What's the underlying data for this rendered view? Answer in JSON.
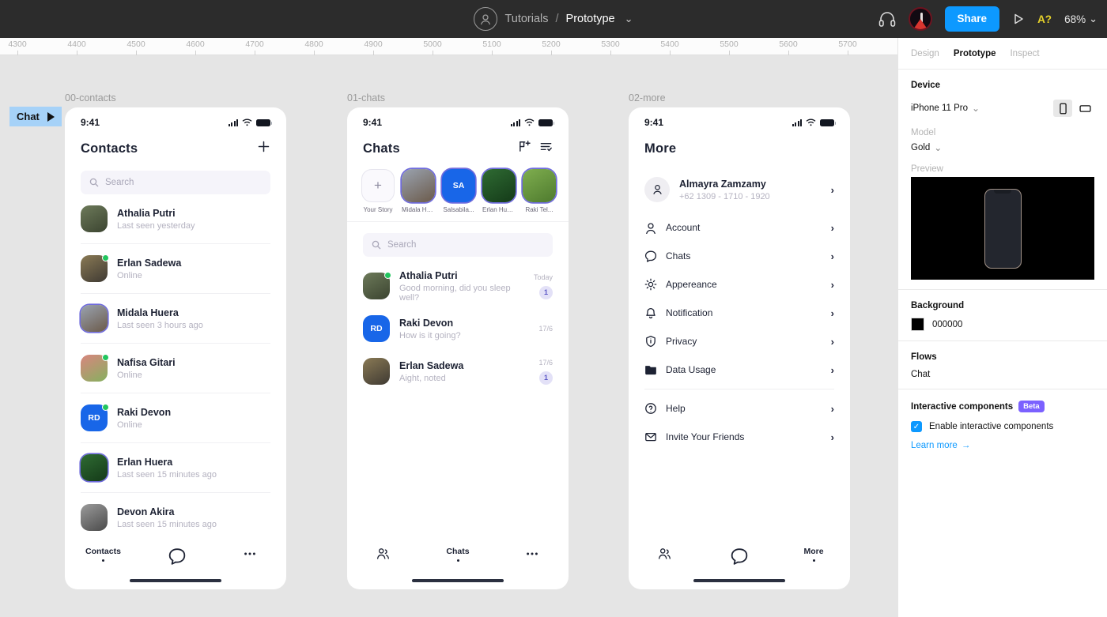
{
  "toolbar": {
    "avatar_icon": "user-circle-icon",
    "breadcrumb_project": "Tutorials",
    "breadcrumb_separator": "/",
    "breadcrumb_file": "Prototype",
    "file_chevron": "⌄",
    "headphones_icon": "headphones-icon",
    "user_avatar": "user-avatar",
    "share_label": "Share",
    "present_icon": "play-icon",
    "a11y_label": "A?",
    "zoom_label": "68%",
    "zoom_chevron": "⌄",
    "accent_color": "#0d99ff",
    "bg_color": "#2c2c2c"
  },
  "ruler": {
    "ticks": [
      "4300",
      "4400",
      "4500",
      "4600",
      "4700",
      "4800",
      "4900",
      "5000",
      "5100",
      "5200",
      "5300",
      "5400",
      "5500",
      "5600",
      "5700"
    ]
  },
  "canvas": {
    "flow_badge": {
      "label": "Chat",
      "icon": "play-triangle-icon"
    },
    "frames": [
      {
        "label": "00-contacts"
      },
      {
        "label": "01-chats"
      },
      {
        "label": "02-more"
      }
    ]
  },
  "status_bar": {
    "time": "9:41",
    "signal_icon": "cellular-signal-icon",
    "wifi_icon": "wifi-icon",
    "battery_icon": "battery-icon"
  },
  "contacts_screen": {
    "title": "Contacts",
    "add_icon": "plus-icon",
    "search": {
      "placeholder": "Search",
      "icon": "search-icon"
    },
    "rows": [
      {
        "name": "Athalia Putri",
        "status": "Last seen yesterday",
        "online": false,
        "ring": false,
        "type": "photo",
        "c1": "#6d7a5a",
        "c2": "#3b4430"
      },
      {
        "name": "Erlan Sadewa",
        "status": "Online",
        "online": true,
        "ring": false,
        "type": "photo",
        "c1": "#8a7a55",
        "c2": "#3f3a33"
      },
      {
        "name": "Midala Huera",
        "status": "Last seen 3 hours ago",
        "online": false,
        "ring": true,
        "type": "photo",
        "c1": "#9aa3b0",
        "c2": "#6b5a4a"
      },
      {
        "name": "Nafisa Gitari",
        "status": "Online",
        "online": true,
        "ring": false,
        "type": "photo",
        "c1": "#d9857f",
        "c2": "#86b05f"
      },
      {
        "name": "Raki Devon",
        "status": "Online",
        "online": true,
        "ring": false,
        "type": "initials",
        "initials": "RD"
      },
      {
        "name": "Erlan Huera",
        "status": "Last seen 15 minutes ago",
        "online": false,
        "ring": true,
        "type": "photo",
        "c1": "#2f6b33",
        "c2": "#143a18"
      },
      {
        "name": "Devon Akira",
        "status": "Last seen 15 minutes ago",
        "online": false,
        "ring": false,
        "type": "photo",
        "c1": "#9b9b9b",
        "c2": "#4a4a4a"
      }
    ],
    "tabbar": {
      "left": {
        "icon": "contacts-people-icon",
        "label": "Contacts",
        "active": true
      },
      "center": {
        "icon": "chat-bubble-icon",
        "label": "Chats",
        "active": false
      },
      "right": {
        "icon": "more-dots-icon",
        "label": "More",
        "active": false
      }
    }
  },
  "chats_screen": {
    "title": "Chats",
    "new_message_icon": "new-message-icon",
    "read_all_icon": "read-all-icon",
    "stories": [
      {
        "caption": "Your Story",
        "type": "add",
        "icon": "plus-icon"
      },
      {
        "caption": "Midala Hu...",
        "type": "photo",
        "c1": "#9aa3b0",
        "c2": "#6b5a4a"
      },
      {
        "caption": "Salsabila...",
        "type": "initials",
        "initials": "SA"
      },
      {
        "caption": "Erlan Huera",
        "type": "photo",
        "c1": "#2f6b33",
        "c2": "#143a18"
      },
      {
        "caption": "Raki Tel...",
        "type": "photo",
        "c1": "#7fae4f",
        "c2": "#4e7a2e"
      }
    ],
    "search": {
      "placeholder": "Search",
      "icon": "search-icon"
    },
    "rows": [
      {
        "name": "Athalia Putri",
        "message": "Good morning, did you sleep well?",
        "time": "Today",
        "unread": "1",
        "online": true,
        "type": "photo",
        "c1": "#6d7a5a",
        "c2": "#3b4430"
      },
      {
        "name": "Raki Devon",
        "message": "How is it going?",
        "time": "17/6",
        "unread": "",
        "online": false,
        "type": "initials",
        "initials": "RD"
      },
      {
        "name": "Erlan Sadewa",
        "message": "Aight, noted",
        "time": "17/6",
        "unread": "1",
        "online": false,
        "type": "photo",
        "c1": "#8a7a55",
        "c2": "#3f3a33"
      }
    ],
    "tabbar": {
      "left": {
        "icon": "contacts-people-icon",
        "label": "Contacts",
        "active": false
      },
      "center": {
        "icon": "chat-bubble-icon",
        "label": "Chats",
        "active": true
      },
      "right": {
        "icon": "more-dots-icon",
        "label": "More",
        "active": false
      }
    }
  },
  "more_screen": {
    "title": "More",
    "profile": {
      "name": "Almayra Zamzamy",
      "phone": "+62 1309 - 1710 - 1920",
      "icon": "person-icon",
      "chevron": "›"
    },
    "items_group_1": [
      {
        "label": "Account",
        "icon": "person-icon",
        "chevron": "›"
      },
      {
        "label": "Chats",
        "icon": "chat-bubble-icon",
        "chevron": "›"
      },
      {
        "label": "Appereance",
        "icon": "brightness-icon",
        "chevron": "›"
      },
      {
        "label": "Notification",
        "icon": "bell-icon",
        "chevron": "›"
      },
      {
        "label": "Privacy",
        "icon": "shield-icon",
        "chevron": "›"
      },
      {
        "label": "Data Usage",
        "icon": "folder-icon",
        "chevron": "›"
      }
    ],
    "items_group_2": [
      {
        "label": "Help",
        "icon": "help-circle-icon",
        "chevron": "›"
      },
      {
        "label": "Invite Your Friends",
        "icon": "mail-icon",
        "chevron": "›"
      }
    ],
    "tabbar": {
      "left": {
        "icon": "contacts-people-icon",
        "label": "Contacts",
        "active": false
      },
      "center": {
        "icon": "chat-bubble-icon",
        "label": "Chats",
        "active": false
      },
      "right": {
        "icon": "more-dots-icon",
        "label": "More",
        "active": true
      }
    }
  },
  "right_panel": {
    "tabs": [
      {
        "label": "Design",
        "active": false
      },
      {
        "label": "Prototype",
        "active": true
      },
      {
        "label": "Inspect",
        "active": false
      }
    ],
    "device": {
      "title": "Device",
      "value": "iPhone 11 Pro",
      "chevron": "⌄",
      "orientation_portrait_icon": "phone-portrait-icon",
      "orientation_landscape_icon": "phone-landscape-icon",
      "orientation_selected": "portrait",
      "model_label": "Model",
      "model_value": "Gold",
      "model_chevron": "⌄",
      "preview_label": "Preview",
      "preview_icon": "device-preview-image"
    },
    "background": {
      "title": "Background",
      "hex": "000000",
      "color": "#000000"
    },
    "flows": {
      "title": "Flows",
      "items": [
        "Chat"
      ]
    },
    "interactive": {
      "title": "Interactive components",
      "badge": "Beta",
      "checkbox_label": "Enable interactive components",
      "checked": true,
      "check_glyph": "✓",
      "learn_more": "Learn more",
      "learn_more_arrow": "→"
    }
  }
}
